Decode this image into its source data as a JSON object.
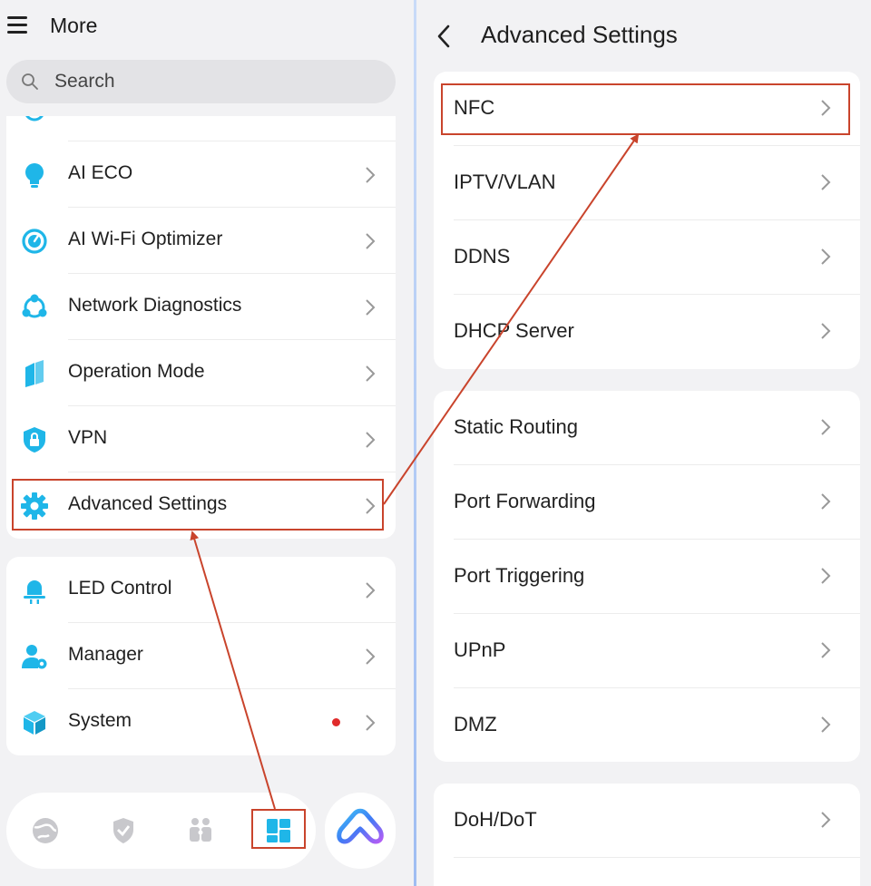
{
  "left": {
    "title": "More",
    "search_placeholder": "Search",
    "menu_items": [
      {
        "label": "AI ECO",
        "icon": "lightbulb-icon"
      },
      {
        "label": "AI Wi-Fi Optimizer",
        "icon": "optimizer-icon"
      },
      {
        "label": "Network Diagnostics",
        "icon": "network-diagnostics-icon"
      },
      {
        "label": "Operation Mode",
        "icon": "operation-mode-icon"
      },
      {
        "label": "VPN",
        "icon": "vpn-shield-icon"
      },
      {
        "label": "Advanced Settings",
        "icon": "gear-icon"
      }
    ],
    "menu_items_2": [
      {
        "label": "LED Control",
        "icon": "led-icon"
      },
      {
        "label": "Manager",
        "icon": "manager-icon"
      },
      {
        "label": "System",
        "icon": "system-cube-icon",
        "badge": "red-dot"
      }
    ],
    "bottom_tabs": [
      "globe-icon",
      "shield-check-icon",
      "family-icon",
      "more-grid-icon"
    ],
    "ai_button_icon": "ai-assistant-icon"
  },
  "right": {
    "title": "Advanced Settings",
    "groups": [
      [
        "NFC",
        "IPTV/VLAN",
        "DDNS",
        "DHCP Server"
      ],
      [
        "Static Routing",
        "Port Forwarding",
        "Port Triggering",
        "UPnP",
        "DMZ"
      ],
      [
        "DoH/DoT"
      ]
    ]
  },
  "colors": {
    "accent": "#1fb6e8",
    "highlight": "#c9442c",
    "badge": "#e02b2b"
  }
}
